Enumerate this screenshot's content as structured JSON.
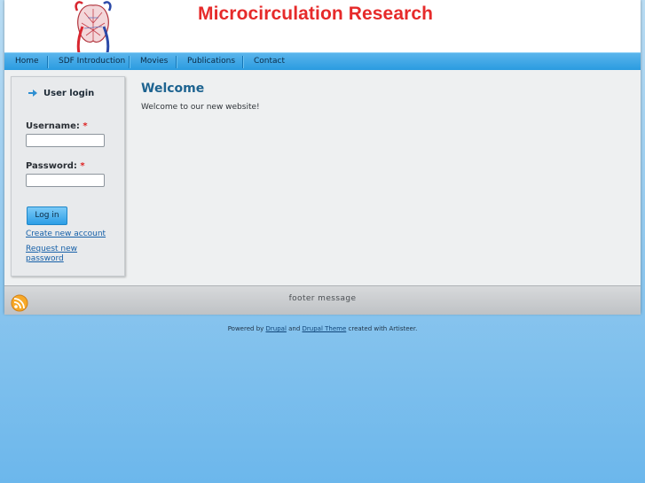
{
  "site": {
    "title": "Microcirculation Research",
    "logo_icon": "microcirculation-logo-icon"
  },
  "nav": {
    "items": [
      {
        "label": "Home"
      },
      {
        "label": "SDF Introduction"
      },
      {
        "label": "Movies"
      },
      {
        "label": "Publications"
      },
      {
        "label": "Contact"
      }
    ]
  },
  "login": {
    "title": "User login",
    "username_label": "Username:",
    "password_label": "Password:",
    "required_mark": "*",
    "username_value": "",
    "password_value": "",
    "submit_label": "Log in",
    "create_account": "Create new account",
    "request_password_line1": "Request new",
    "request_password_line2": "password"
  },
  "main": {
    "title": "Welcome",
    "body": "Welcome to our new website!"
  },
  "footer": {
    "message": "footer message",
    "rss_icon": "rss-icon"
  },
  "credits": {
    "prefix": "Powered by ",
    "drupal": "Drupal",
    "and": " and ",
    "theme": "Drupal Theme",
    "suffix": " created with Artisteer."
  },
  "colors": {
    "title_red": "#e62a2a",
    "nav_blue": "#2a9be0",
    "heading_blue": "#1d6390"
  }
}
